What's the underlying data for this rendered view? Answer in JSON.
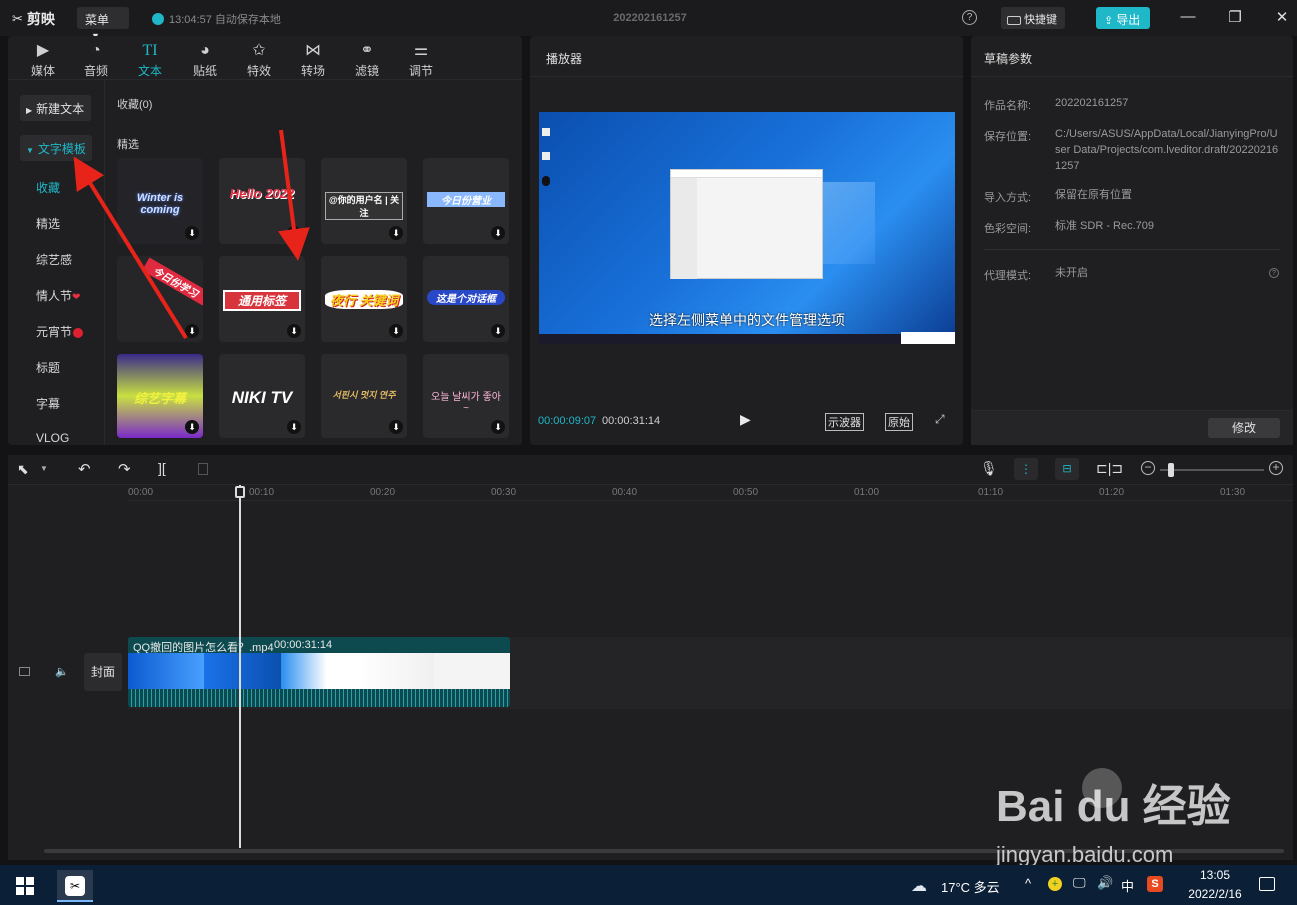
{
  "topbar": {
    "app_name": "剪映",
    "menu_label": "菜单",
    "autosave_text": "13:04:57 自动保存本地",
    "doc_title": "202202161257",
    "help": "?",
    "shortcut_label": "快捷键",
    "export_label": "导出"
  },
  "tabs": [
    {
      "label": "媒体",
      "icon": "media-icon",
      "glyph": "▶"
    },
    {
      "label": "音频",
      "icon": "audio-icon",
      "glyph": "◔"
    },
    {
      "label": "文本",
      "icon": "text-icon",
      "glyph": "TI"
    },
    {
      "label": "贴纸",
      "icon": "sticker-icon",
      "glyph": "◕"
    },
    {
      "label": "特效",
      "icon": "effects-icon",
      "glyph": "✩"
    },
    {
      "label": "转场",
      "icon": "transition-icon",
      "glyph": "⋈"
    },
    {
      "label": "滤镜",
      "icon": "filter-icon",
      "glyph": "⚭"
    },
    {
      "label": "调节",
      "icon": "adjust-icon",
      "glyph": "⚌"
    }
  ],
  "left_nav": {
    "new_text": "新建文本",
    "text_template": "文字模板",
    "items": [
      "收藏",
      "精选",
      "综艺感",
      "情人节",
      "元宵节",
      "标题",
      "字幕",
      "VLOG"
    ]
  },
  "content": {
    "favorites_label": "收藏(0)",
    "featured_label": "精选",
    "thumbs": [
      "Winter is coming",
      "Hello 2022",
      "@你的用户名 | 关注",
      "今日份营业",
      "今日份学习",
      "通用标签",
      "夜行 关键词",
      "这是个对话框",
      "综艺字幕",
      "NIKI TV",
      "서핀시 멋지 연주",
      "오늘 날씨가 좋아 ~"
    ]
  },
  "player": {
    "title": "播放器",
    "subtitle": "选择左侧菜单中的文件管理选项",
    "current_time": "00:00:09:07",
    "total_time": "00:00:31:14",
    "scope_label": "示波器",
    "original_label": "原始"
  },
  "params": {
    "title": "草稿参数",
    "rows": [
      {
        "k": "作品名称:",
        "v": "202202161257"
      },
      {
        "k": "保存位置:",
        "v": "C:/Users/ASUS/AppData/Local/JianyingPro/User Data/Projects/com.lveditor.draft/202202161257"
      },
      {
        "k": "导入方式:",
        "v": "保留在原有位置"
      },
      {
        "k": "色彩空间:",
        "v": "标准 SDR - Rec.709"
      },
      {
        "k": "代理模式:",
        "v": "未开启"
      }
    ],
    "modify_label": "修改"
  },
  "timeline": {
    "ruler": [
      "00:00",
      "00:10",
      "00:20",
      "00:30",
      "00:40",
      "00:50",
      "01:00",
      "01:10",
      "01:20",
      "01:30"
    ],
    "clip_name": "QQ撤回的图片怎么看？.mp4",
    "clip_duration": "00:00:31:14",
    "cover_label": "封面"
  },
  "taskbar": {
    "weather": "17°C 多云",
    "ime": "中",
    "time": "13:05",
    "date": "2022/2/16"
  },
  "watermark": {
    "brand": "Bai du 经验",
    "url": "jingyan.baidu.com"
  },
  "colors": {
    "accent": "#1fb8c8",
    "annotation": "#e8231a"
  }
}
